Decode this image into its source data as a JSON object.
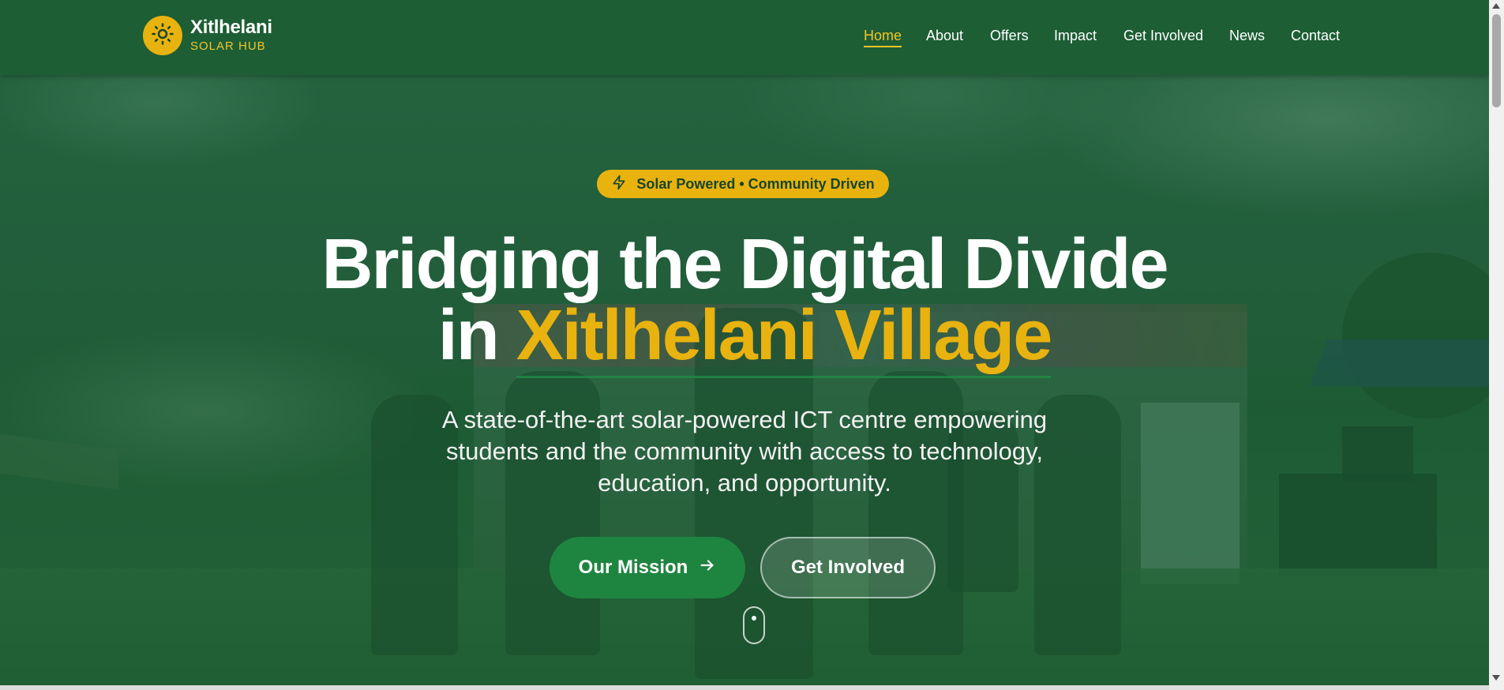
{
  "header": {
    "brand_name": "Xitlhelani",
    "brand_sub": "SOLAR HUB",
    "logo_icon": "sun-icon",
    "accent_color": "#e8b20f",
    "background_color": "#1d5e34"
  },
  "nav": {
    "items": [
      {
        "label": "Home",
        "active": true
      },
      {
        "label": "About"
      },
      {
        "label": "Offers"
      },
      {
        "label": "Impact"
      },
      {
        "label": "Get Involved"
      },
      {
        "label": "News"
      },
      {
        "label": "Contact"
      }
    ]
  },
  "hero": {
    "badge_icon": "lightning-icon",
    "badge_text": "Solar Powered • Community Driven",
    "title_line1": "Bridging the Digital Divide",
    "title_line2_prefix": "in ",
    "title_line2_highlight": "Xitlhelani Village",
    "subtitle": "A state-of-the-art solar-powered ICT centre empowering students and the community with access to technology, education, and opportunity.",
    "primary_button": "Our Mission",
    "primary_button_icon": "arrow-right-icon",
    "secondary_button": "Get Involved",
    "scroll_indicator_icon": "mouse-scroll-icon"
  }
}
